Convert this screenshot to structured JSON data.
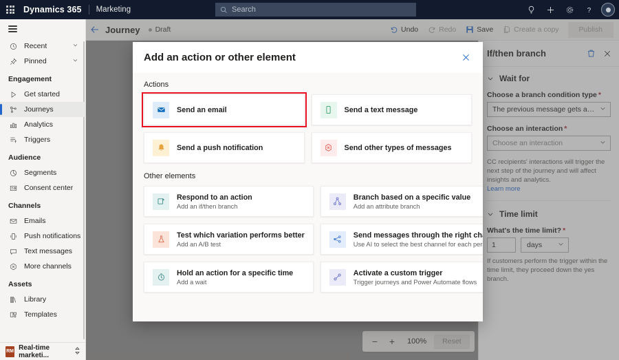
{
  "suite": {
    "waffle_icon": "app-launcher-icon",
    "brand": "Dynamics 365",
    "app_name": "Marketing",
    "search": {
      "placeholder": "Search",
      "icon": "search-icon"
    },
    "actions": [
      {
        "name": "lightbulb-icon",
        "glyph": "idea"
      },
      {
        "name": "plus-icon",
        "glyph": "plus"
      },
      {
        "name": "gear-icon",
        "glyph": "gear"
      },
      {
        "name": "help-icon",
        "glyph": "question"
      }
    ],
    "avatar_label": "user-avatar"
  },
  "sidebar": {
    "hamburger_label": "Expand navigation",
    "top_items": [
      {
        "label": "Recent",
        "icon": "clock-icon",
        "expandable": true
      },
      {
        "label": "Pinned",
        "icon": "pin-icon",
        "expandable": true
      }
    ],
    "groups": [
      {
        "title": "Engagement",
        "items": [
          {
            "label": "Get started",
            "icon": "play-icon",
            "selected": false
          },
          {
            "label": "Journeys",
            "icon": "journeys-icon",
            "selected": true
          },
          {
            "label": "Analytics",
            "icon": "analytics-icon",
            "selected": false
          },
          {
            "label": "Triggers",
            "icon": "triggers-icon",
            "selected": false
          }
        ]
      },
      {
        "title": "Audience",
        "items": [
          {
            "label": "Segments",
            "icon": "segments-icon",
            "selected": false
          },
          {
            "label": "Consent center",
            "icon": "consent-icon",
            "selected": false
          }
        ]
      },
      {
        "title": "Channels",
        "items": [
          {
            "label": "Emails",
            "icon": "email-icon",
            "selected": false
          },
          {
            "label": "Push notifications",
            "icon": "push-icon",
            "selected": false
          },
          {
            "label": "Text messages",
            "icon": "sms-icon",
            "selected": false
          },
          {
            "label": "More channels",
            "icon": "more-channels-icon",
            "selected": false
          }
        ]
      },
      {
        "title": "Assets",
        "items": [
          {
            "label": "Library",
            "icon": "library-icon",
            "selected": false
          },
          {
            "label": "Templates",
            "icon": "templates-icon",
            "selected": false
          }
        ]
      }
    ],
    "footer": {
      "badge": "RM",
      "label": "Real-time marketi...",
      "icon": "area-switcher-icon"
    }
  },
  "commandbar": {
    "back_icon": "back-arrow-icon",
    "title": "Journey",
    "status": "Draft",
    "buttons": [
      {
        "label": "Undo",
        "icon": "undo-icon",
        "disabled": false
      },
      {
        "label": "Redo",
        "icon": "redo-icon",
        "disabled": true
      },
      {
        "label": "Save",
        "icon": "save-icon",
        "disabled": false
      },
      {
        "label": "Create a copy",
        "icon": "copy-icon",
        "disabled": true
      }
    ],
    "publish_label": "Publish"
  },
  "canvas": {
    "zoom": {
      "minus_label": "−",
      "plus_label": "+",
      "level": "100%",
      "reset_label": "Reset"
    }
  },
  "right_panel": {
    "title": "If/then branch",
    "delete_icon": "trash-icon",
    "close_icon": "close-icon",
    "sections": [
      {
        "name": "wait-for",
        "heading": "Wait for",
        "fields": [
          {
            "label": "Choose a branch condition type",
            "required": true,
            "value": "The previous message gets an interacti...",
            "is_placeholder": false
          },
          {
            "label": "Choose an interaction",
            "required": true,
            "value": "Choose an interaction",
            "is_placeholder": true
          }
        ],
        "help": "CC recipients' interactions will trigger the next step of the journey and will affect insights and analytics.",
        "link": "Learn more"
      },
      {
        "name": "time-limit",
        "heading": "Time limit",
        "field_label": "What's the time limit?",
        "required": true,
        "amount": "1",
        "unit": "days",
        "help": "If customers perform the trigger within the time limit, they proceed down the yes branch."
      }
    ]
  },
  "modal": {
    "title": "Add an action or other element",
    "close_icon": "close-icon",
    "groups": [
      {
        "label": "Actions",
        "cards": [
          {
            "title": "Send an email",
            "subtitle": "",
            "icon": "envelope-icon",
            "tile_bg": "#deecf9",
            "icon_color": "#0f6cbd",
            "highlighted": true
          },
          {
            "title": "Send a text message",
            "subtitle": "",
            "icon": "phone-icon",
            "tile_bg": "#e7f7ef",
            "icon_color": "#3aa06a",
            "highlighted": false
          },
          {
            "title": "Send a push notification",
            "subtitle": "",
            "icon": "bell-icon",
            "tile_bg": "#fdf0d3",
            "icon_color": "#e8a33d",
            "highlighted": false
          },
          {
            "title": "Send other types of messages",
            "subtitle": "",
            "icon": "custom-channel-icon",
            "tile_bg": "#fdeceb",
            "icon_color": "#e0584f",
            "highlighted": false
          }
        ]
      },
      {
        "label": "Other elements",
        "cards": [
          {
            "title": "Respond to an action",
            "subtitle": "Add an if/then branch",
            "icon": "if-then-icon",
            "tile_bg": "#e3f1f0",
            "icon_color": "#3f8b87",
            "highlighted": false
          },
          {
            "title": "Branch based on a specific value",
            "subtitle": "Add an attribute branch",
            "icon": "attribute-branch-icon",
            "tile_bg": "#eaeaf8",
            "icon_color": "#6b70c8",
            "highlighted": false
          },
          {
            "title": "Test which variation performs better",
            "subtitle": "Add an A/B test",
            "icon": "flask-icon",
            "tile_bg": "#fbe3da",
            "icon_color": "#d9694a",
            "highlighted": false
          },
          {
            "title": "Send messages through the right channel",
            "subtitle": "Use AI to select the best channel for each person",
            "icon": "channel-optimization-icon",
            "tile_bg": "#e3edfb",
            "icon_color": "#4a7fd4",
            "highlighted": false
          },
          {
            "title": "Hold an action for a specific time",
            "subtitle": "Add a wait",
            "icon": "clock-wait-icon",
            "tile_bg": "#e3f1f0",
            "icon_color": "#3f8b87",
            "highlighted": false
          },
          {
            "title": "Activate a custom trigger",
            "subtitle": "Trigger journeys and Power Automate flows",
            "icon": "custom-trigger-icon",
            "tile_bg": "#eaeaf8",
            "icon_color": "#6b70c8",
            "highlighted": false
          }
        ]
      }
    ]
  },
  "colors": {
    "suitebar_bg": "#111b2d",
    "accent": "#2266cc",
    "highlight_red": "#e81123",
    "canvas_bg": "#8e8d8c"
  }
}
